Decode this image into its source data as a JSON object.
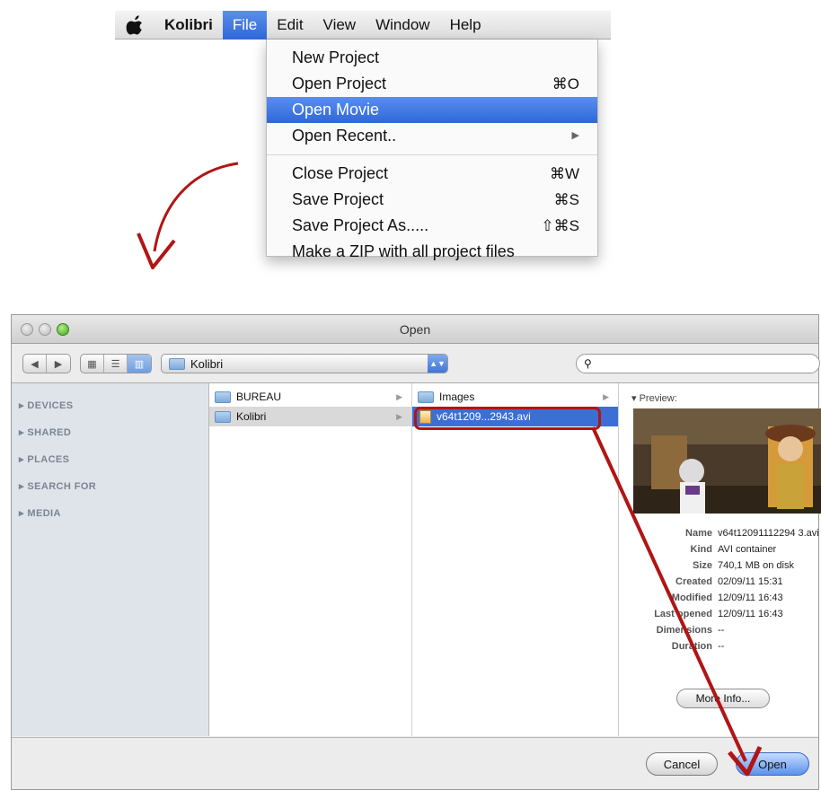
{
  "menubar": {
    "apple_icon": "apple-logo",
    "app_name": "Kolibri",
    "items": [
      "File",
      "Edit",
      "View",
      "Window",
      "Help"
    ],
    "active": "File"
  },
  "file_menu": {
    "items": [
      {
        "label": "New Project",
        "shortcut": ""
      },
      {
        "label": "Open Project",
        "shortcut": "⌘O"
      },
      {
        "label": "Open Movie",
        "shortcut": ""
      },
      {
        "label": "Open Recent..",
        "shortcut": "▶"
      },
      {
        "label": "Close Project",
        "shortcut": "⌘W"
      },
      {
        "label": "Save Project",
        "shortcut": "⌘S"
      },
      {
        "label": "Save Project As.....",
        "shortcut": "⇧⌘S"
      },
      {
        "label": "Make a ZIP with all project files",
        "shortcut": ""
      }
    ],
    "selected": "Open Movie"
  },
  "dialog": {
    "title": "Open",
    "location_popup": "Kolibri",
    "search_placeholder": "",
    "sidebar": [
      "DEVICES",
      "SHARED",
      "PLACES",
      "SEARCH FOR",
      "MEDIA"
    ],
    "column1": [
      "BUREAU",
      "Kolibri"
    ],
    "column2": [
      {
        "name": "Images",
        "type": "folder"
      },
      {
        "name": "v64t1209...2943.avi",
        "type": "file"
      }
    ],
    "preview": {
      "label": "Preview:",
      "info": [
        {
          "key": "Name",
          "value": "v64t12091112294 3.avi"
        },
        {
          "key": "Kind",
          "value": "AVI container"
        },
        {
          "key": "Size",
          "value": "740,1 MB on disk"
        },
        {
          "key": "Created",
          "value": "02/09/11 15:31"
        },
        {
          "key": "Modified",
          "value": "12/09/11 16:43"
        },
        {
          "key": "Last opened",
          "value": "12/09/11 16:43"
        },
        {
          "key": "Dimensions",
          "value": "--"
        },
        {
          "key": "Duration",
          "value": "--"
        }
      ],
      "more_info_label": "More Info..."
    },
    "cancel_label": "Cancel",
    "open_label": "Open"
  },
  "colors": {
    "highlight": "#3b6fd4",
    "annotation": "#b01515"
  }
}
